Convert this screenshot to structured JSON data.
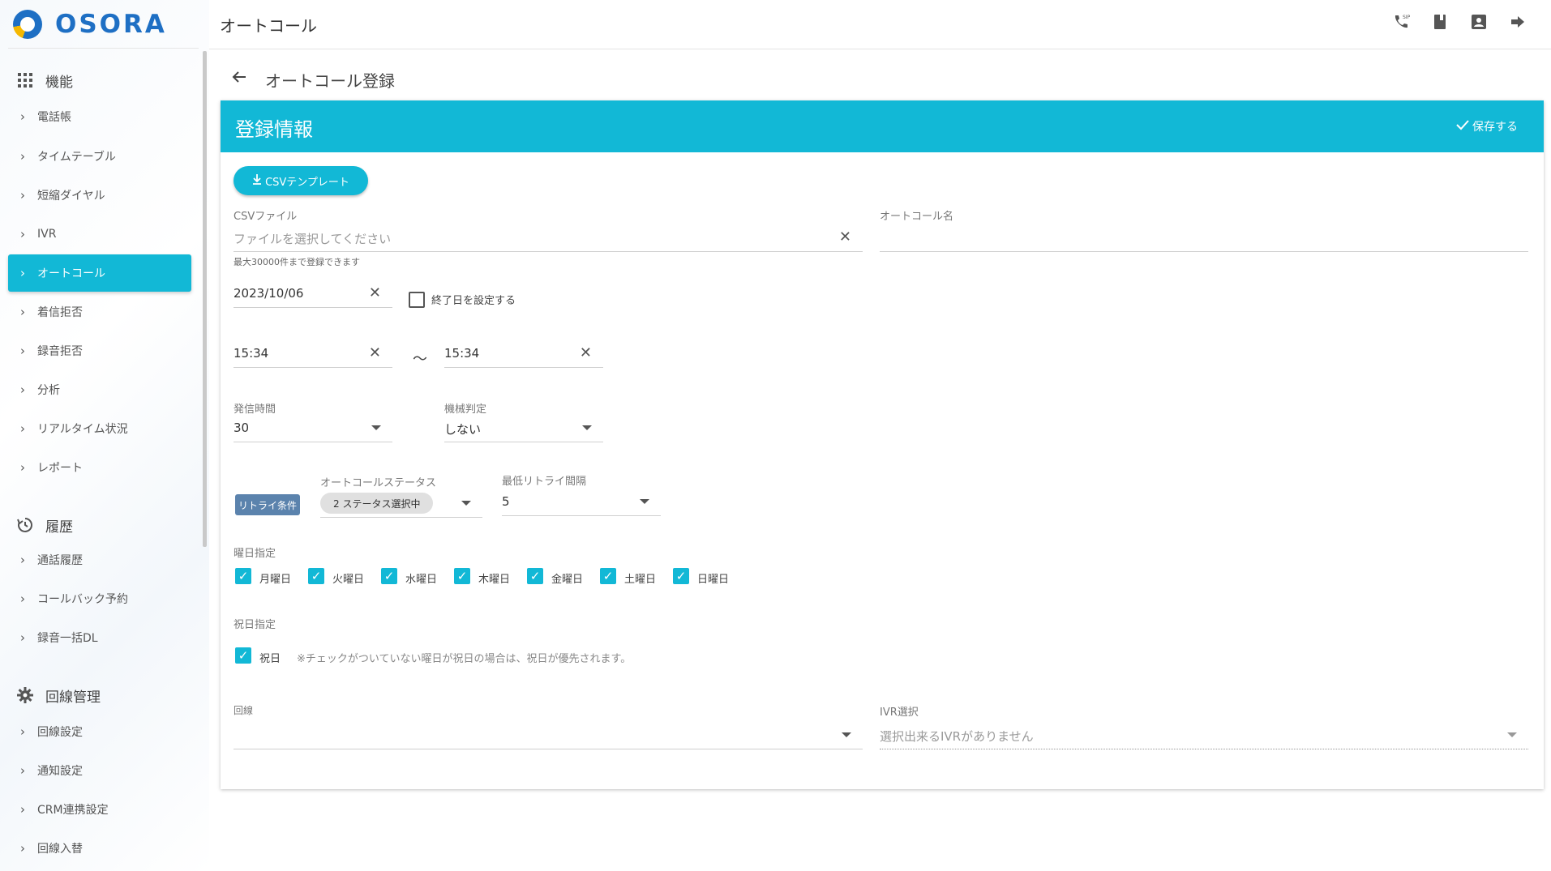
{
  "app": {
    "logo_text": "OSORA"
  },
  "topbar": {
    "title": "オートコール",
    "icons": [
      "sip-phone-icon",
      "book-icon",
      "contact-icon",
      "logout-icon"
    ]
  },
  "sidebar": {
    "sections": [
      {
        "title": "機能",
        "icon": "grid-icon",
        "items": [
          "電話帳",
          "タイムテーブル",
          "短縮ダイヤル",
          "IVR",
          "オートコール",
          "着信拒否",
          "録音拒否",
          "分析",
          "リアルタイム状況",
          "レポート"
        ]
      },
      {
        "title": "履歴",
        "icon": "history-icon",
        "items": [
          "通話履歴",
          "コールバック予約",
          "録音一括DL"
        ]
      },
      {
        "title": "回線管理",
        "icon": "gear-icon",
        "items": [
          "回線設定",
          "通知設定",
          "CRM連携設定",
          "回線入替"
        ]
      }
    ],
    "active_item": "オートコール"
  },
  "page": {
    "title": "オートコール登録"
  },
  "card": {
    "header_title": "登録情報",
    "save_label": "保存する"
  },
  "form": {
    "csv_template_button": "CSVテンプレート",
    "csv_file": {
      "label": "CSVファイル",
      "placeholder": "ファイルを選択してください",
      "hint": "最大30000件まで登録できます"
    },
    "autocall_name": {
      "label": "オートコール名",
      "value": ""
    },
    "start_date": "2023/10/06",
    "end_date_checkbox": {
      "label": "終了日を設定する",
      "checked": false
    },
    "time_from": "15:34",
    "time_separator": "～",
    "time_to": "15:34",
    "call_time": {
      "label": "発信時間",
      "value": "30"
    },
    "machine_detect": {
      "label": "機械判定",
      "value": "しない"
    },
    "retry_tag": "リトライ条件",
    "autocall_status": {
      "label": "オートコールステータス",
      "chip": "2 ステータス選択中"
    },
    "min_retry_interval": {
      "label": "最低リトライ間隔",
      "value": "5"
    },
    "weekday": {
      "label": "曜日指定",
      "days": [
        "月曜日",
        "火曜日",
        "水曜日",
        "木曜日",
        "金曜日",
        "土曜日",
        "日曜日"
      ],
      "checked": [
        true,
        true,
        true,
        true,
        true,
        true,
        true
      ]
    },
    "holiday": {
      "label": "祝日指定",
      "checkbox_label": "祝日",
      "checked": true,
      "note": "※チェックがついていない曜日が祝日の場合は、祝日が優先されます。"
    },
    "line": {
      "label": "回線",
      "value": ""
    },
    "ivr": {
      "label": "IVR選択",
      "placeholder": "選択出来るIVRがありません"
    }
  }
}
